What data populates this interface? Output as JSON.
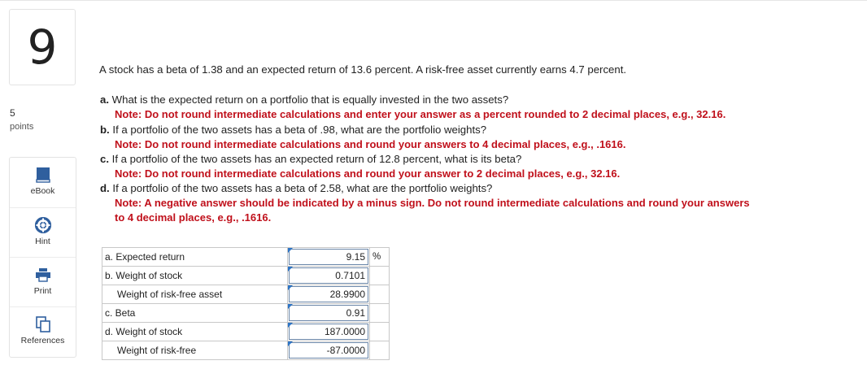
{
  "question": {
    "number": "9",
    "points_value": "5",
    "points_label": "points"
  },
  "tools": [
    {
      "label": "eBook",
      "icon": "book-icon"
    },
    {
      "label": "Hint",
      "icon": "hint-icon"
    },
    {
      "label": "Print",
      "icon": "print-icon"
    },
    {
      "label": "References",
      "icon": "references-icon"
    }
  ],
  "intro": "A stock has a beta of 1.38 and an expected return of 13.6 percent. A risk-free asset currently earns 4.7 percent.",
  "parts": [
    {
      "letter": "a.",
      "text": "What is the expected return on a portfolio that is equally invested in the two assets?",
      "note": "Note: Do not round intermediate calculations and enter your answer as a percent rounded to 2 decimal places, e.g., 32.16."
    },
    {
      "letter": "b.",
      "text": "If a portfolio of the two assets has a beta of .98, what are the portfolio weights?",
      "note": "Note: Do not round intermediate calculations and round your answers to 4 decimal places, e.g., .1616."
    },
    {
      "letter": "c.",
      "text": "If a portfolio of the two assets has an expected return of 12.8 percent, what is its beta?",
      "note": "Note: Do not round intermediate calculations and round your answer to 2 decimal places, e.g., 32.16."
    },
    {
      "letter": "d.",
      "text": "If a portfolio of the two assets has a beta of 2.58, what are the portfolio weights?",
      "note_line1": "Note: A negative answer should be indicated by a minus sign. Do not round intermediate calculations and round your answers",
      "note_line2": "to 4 decimal places, e.g., .1616."
    }
  ],
  "answers": [
    {
      "label": "a. Expected return",
      "value": "9.15",
      "unit": "%"
    },
    {
      "label": "b. Weight of stock",
      "value": "0.7101",
      "unit": ""
    },
    {
      "label": "Weight of risk-free asset",
      "value": "28.9900",
      "unit": ""
    },
    {
      "label": "c. Beta",
      "value": "0.91",
      "unit": ""
    },
    {
      "label": "d. Weight of stock",
      "value": "187.0000",
      "unit": ""
    },
    {
      "label": "Weight of risk-free",
      "value": "-87.0000",
      "unit": ""
    }
  ],
  "colors": {
    "note_red": "#c0101b",
    "field_border": "#6a86a8",
    "flag_blue": "#2e75c6",
    "icon_blue": "#2f5f9e"
  }
}
